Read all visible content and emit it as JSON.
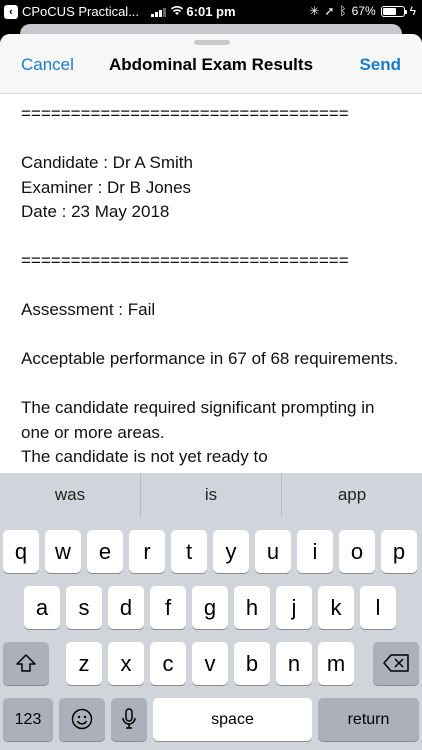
{
  "status_bar": {
    "app_name": "CPoCUS Practical...",
    "time": "6:01 pm",
    "battery": "67%",
    "battery_level": 0.67
  },
  "nav": {
    "cancel_label": "Cancel",
    "title": "Abdominal Exam Results",
    "send_label": "Send"
  },
  "message": {
    "separator": "=================================",
    "candidate": "Candidate : Dr A Smith",
    "examiner": "Examiner : Dr B Jones",
    "date": "Date : 23 May 2018",
    "assessment": "Assessment : Fail",
    "performance": "Acceptable performance in 67 of 68 requirements.",
    "prompting": "The candidate required significant prompting in one or more areas.",
    "cut_off_line": "The candidate is not yet ready to"
  },
  "keyboard": {
    "suggestions": [
      "was",
      "is",
      "app"
    ],
    "row1": [
      "q",
      "w",
      "e",
      "r",
      "t",
      "y",
      "u",
      "i",
      "o",
      "p"
    ],
    "row2": [
      "a",
      "s",
      "d",
      "f",
      "g",
      "h",
      "j",
      "k",
      "l"
    ],
    "row3": [
      "z",
      "x",
      "c",
      "v",
      "b",
      "n",
      "m"
    ],
    "numbers_label": "123",
    "space_label": "space",
    "return_label": "return"
  }
}
